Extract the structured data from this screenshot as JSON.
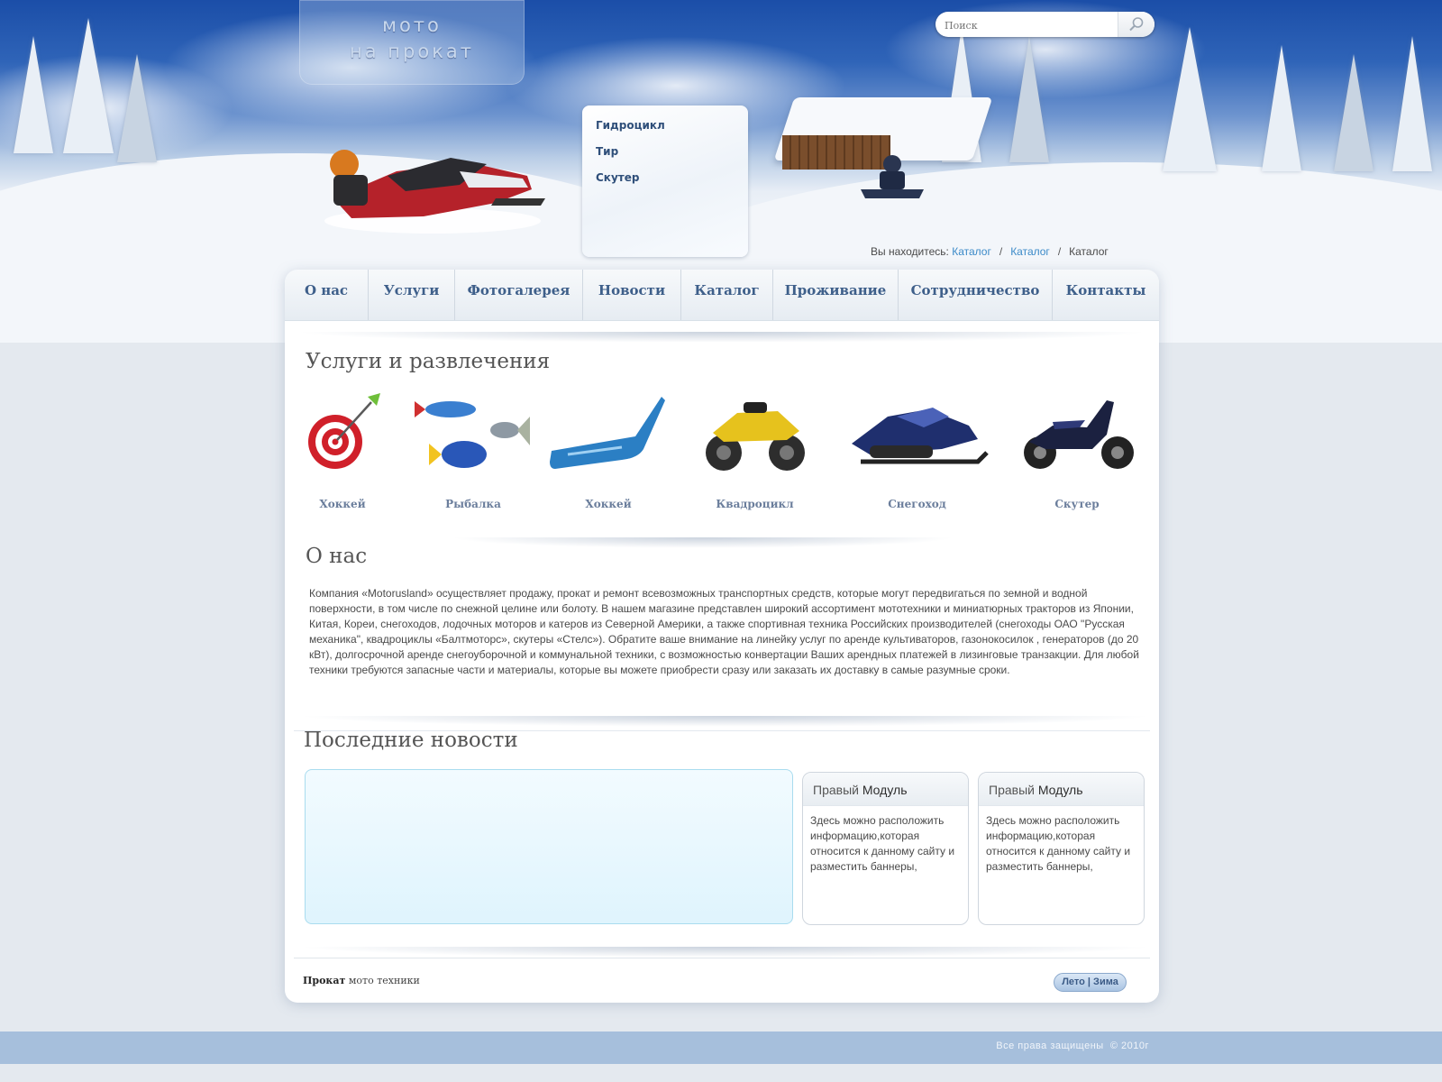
{
  "logo": {
    "line1": "мото",
    "line2": "на прокат"
  },
  "search": {
    "placeholder": "Поиск",
    "button_icon": "search-icon"
  },
  "submenu": [
    "Гидроцикл",
    "Тир",
    "Скутер"
  ],
  "breadcrumb": {
    "prefix": "Вы находитесь:",
    "items": [
      "Каталог",
      "Каталог",
      "Каталог"
    ],
    "separator": "/"
  },
  "nav": [
    "О нас",
    "Услуги",
    "Фотогалерея",
    "Новости",
    "Каталог",
    "Проживание",
    "Сотрудничество",
    "Контакты"
  ],
  "services": {
    "title": "Услуги и развлечения",
    "items": [
      {
        "label": "Хоккей",
        "icon": "dart-target-icon"
      },
      {
        "label": "Рыбалка",
        "icon": "fish-icon"
      },
      {
        "label": "Хоккей",
        "icon": "hockey-stick-icon"
      },
      {
        "label": "Квадроцикл",
        "icon": "quad-bike-icon"
      },
      {
        "label": "Снегоход",
        "icon": "snowmobile-icon"
      },
      {
        "label": "Скутер",
        "icon": "scooter-icon"
      }
    ]
  },
  "about": {
    "title": "О нас",
    "text": "Компания «Motorusland» осуществляет продажу, прокат и ремонт всевозможных транспортных средств, которые могут передвигаться по земной и водной поверхности, в том числе по снежной целине или болоту. В нашем магазине представлен широкий ассортимент мототехники и миниатюрных тракторов из Японии, Китая, Кореи, снегоходов, лодочных моторов и катеров из Северной Америки, а также спортивная техника Российских производителей (снегоходы ОАО \"Русская механика\", квадроциклы «Балтмоторс», скутеры «Стелс»). Обратите ваше внимание на линейку услуг по аренде культиваторов, газонокосилок , генераторов (до 20 кВт), долгосрочной аренде снегоуборочной и коммунальной техники, с возможностью конвертации Ваших арендных платежей в лизинговые транзакции. Для любой техники требуются запасные части и материалы, которые вы можете приобрести сразу или заказать их доставку в самые разумные сроки."
  },
  "news": {
    "title": "Последние новости"
  },
  "modules": [
    {
      "title_light": "Правый",
      "title_bold": "Модуль",
      "text": "Здесь можно расположить информацию,которая относится к данному сайту и разместить баннеры,"
    },
    {
      "title_light": "Правый",
      "title_bold": "Модуль",
      "text": "Здесь можно расположить информацию,которая относится к данному сайту и разместить баннеры,"
    }
  ],
  "footer": {
    "left_bold": "Прокат",
    "left_rest": "мото техники",
    "toggle_left": "Лето",
    "toggle_sep": "|",
    "toggle_right": "Зима",
    "copyright": "Все права защищены",
    "year": "2010г"
  },
  "colors": {
    "nav_text": "#3e5f8a",
    "link": "#3b8ac8",
    "bottom_bar": "#a6bfdc",
    "news_box": "#dff4fd"
  }
}
